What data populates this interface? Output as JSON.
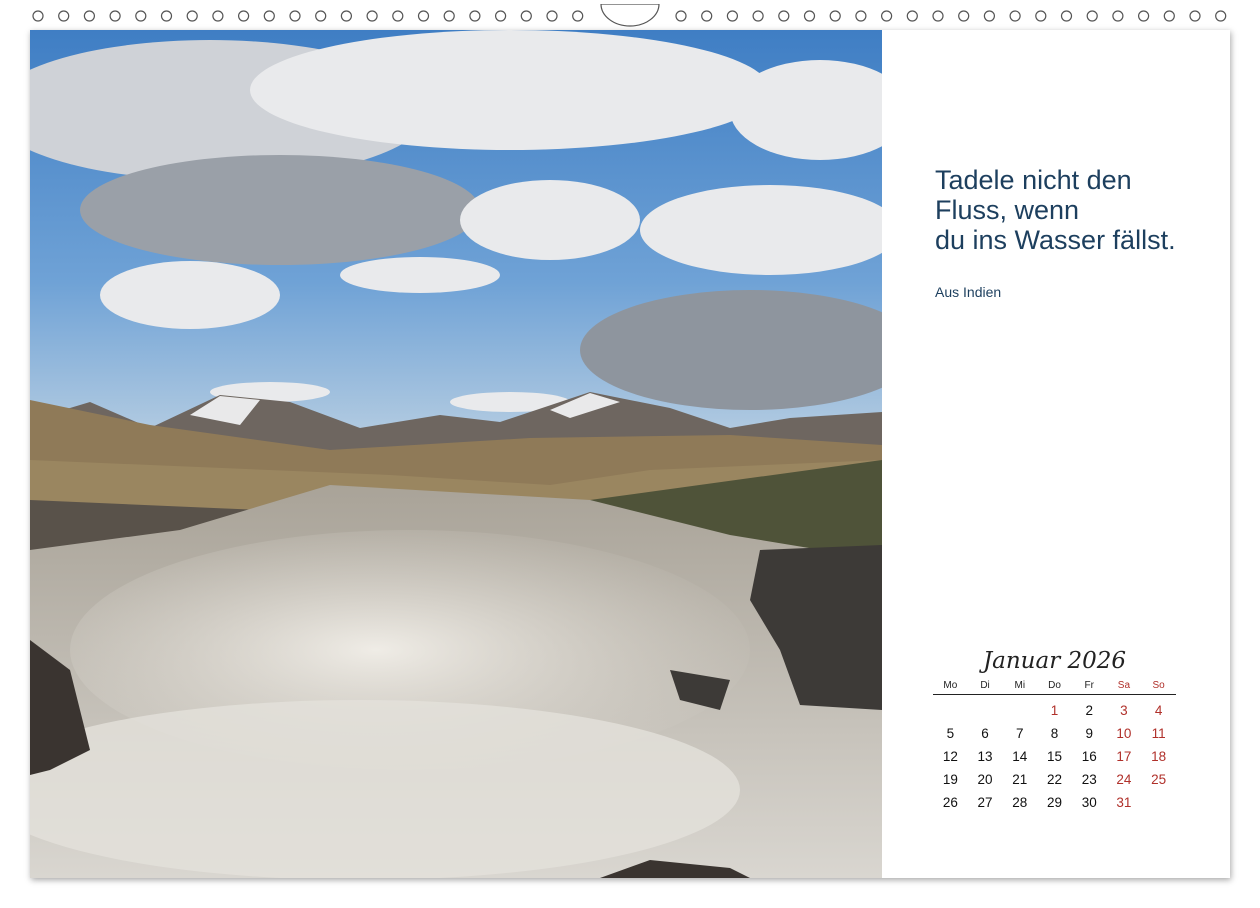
{
  "quote": {
    "lines": [
      "Tadele nicht den",
      "Fluss, wenn",
      "du ins Wasser fällst."
    ],
    "source": "Aus Indien"
  },
  "calendar": {
    "title": "Januar 2026",
    "weekdays": [
      "Mo",
      "Di",
      "Mi",
      "Do",
      "Fr",
      "Sa",
      "So"
    ],
    "weekend_color": "#b0302a",
    "leading_blanks": 3,
    "days": [
      "1",
      "2",
      "3",
      "4",
      "5",
      "6",
      "7",
      "8",
      "9",
      "10",
      "11",
      "12",
      "13",
      "14",
      "15",
      "16",
      "17",
      "18",
      "19",
      "20",
      "21",
      "22",
      "23",
      "24",
      "25",
      "26",
      "27",
      "28",
      "29",
      "30",
      "31"
    ]
  },
  "colors": {
    "text_blue": "#1d3f5e",
    "holiday_red": "#b0302a"
  },
  "photo": {
    "subject": "waterfall-landscape-image"
  }
}
